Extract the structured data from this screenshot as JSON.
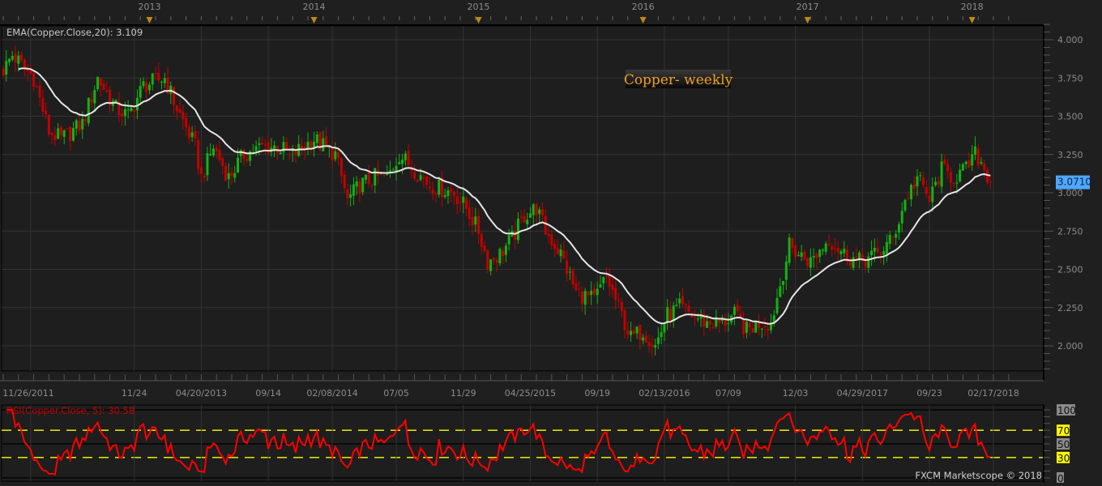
{
  "chart_data": [
    {
      "type": "candlestick",
      "title": "Copper- weekly",
      "instrument": "Copper",
      "timeframe": "weekly",
      "indicator_label": "EMA(Copper.Close,20): 3.109",
      "ema_period": 20,
      "current_price_label": "3.0710",
      "ylim": [
        1.83,
        4.1
      ],
      "y_ticks": [
        "4.000",
        "3.750",
        "3.500",
        "3.250",
        "3.000",
        "2.750",
        "2.500",
        "2.250",
        "2.000"
      ],
      "y_tick_values": [
        4.0,
        3.75,
        3.5,
        3.25,
        3.0,
        2.75,
        2.5,
        2.25,
        2.0
      ],
      "years": [
        "2013",
        "2014",
        "2015",
        "2016",
        "2017",
        "2018"
      ],
      "year_week_index": [
        48,
        102,
        156,
        210,
        264,
        318
      ],
      "x_tick_labels": [
        "11/26/2011",
        "11/24",
        "04/20/2013",
        "09/14",
        "02/08/2014",
        "07/05",
        "11/29",
        "04/25/2015",
        "09/19",
        "02/13/2016",
        "07/09",
        "12/03",
        "04/29/2017",
        "09/23",
        "02/17/2018"
      ],
      "x_tick_week_index": [
        9,
        43,
        65,
        87,
        108,
        129,
        151,
        173,
        195,
        217,
        238,
        260,
        282,
        304,
        325
      ],
      "weeks": 324,
      "close_anchors_week_price": [
        [
          0,
          3.8
        ],
        [
          3,
          3.9
        ],
        [
          10,
          3.75
        ],
        [
          15,
          3.4
        ],
        [
          19,
          3.35
        ],
        [
          26,
          3.45
        ],
        [
          31,
          3.75
        ],
        [
          37,
          3.55
        ],
        [
          41,
          3.5
        ],
        [
          46,
          3.7
        ],
        [
          53,
          3.75
        ],
        [
          57,
          3.55
        ],
        [
          63,
          3.3
        ],
        [
          65,
          3.1
        ],
        [
          69,
          3.3
        ],
        [
          74,
          3.1
        ],
        [
          79,
          3.25
        ],
        [
          85,
          3.3
        ],
        [
          90,
          3.3
        ],
        [
          95,
          3.25
        ],
        [
          102,
          3.35
        ],
        [
          109,
          3.25
        ],
        [
          113,
          2.95
        ],
        [
          117,
          3.05
        ],
        [
          122,
          3.1
        ],
        [
          126,
          3.1
        ],
        [
          130,
          3.25
        ],
        [
          135,
          3.15
        ],
        [
          140,
          3.05
        ],
        [
          148,
          3.0
        ],
        [
          152,
          2.9
        ],
        [
          156,
          2.75
        ],
        [
          159,
          2.55
        ],
        [
          163,
          2.6
        ],
        [
          167,
          2.7
        ],
        [
          171,
          2.85
        ],
        [
          175,
          2.9
        ],
        [
          178,
          2.75
        ],
        [
          183,
          2.6
        ],
        [
          188,
          2.35
        ],
        [
          194,
          2.3
        ],
        [
          198,
          2.45
        ],
        [
          202,
          2.25
        ],
        [
          206,
          2.05
        ],
        [
          210,
          2.1
        ],
        [
          214,
          2.0
        ],
        [
          218,
          2.2
        ],
        [
          222,
          2.25
        ],
        [
          226,
          2.2
        ],
        [
          231,
          2.15
        ],
        [
          236,
          2.15
        ],
        [
          240,
          2.2
        ],
        [
          244,
          2.1
        ],
        [
          248,
          2.15
        ],
        [
          252,
          2.15
        ],
        [
          255,
          2.4
        ],
        [
          258,
          2.65
        ],
        [
          261,
          2.6
        ],
        [
          265,
          2.55
        ],
        [
          271,
          2.7
        ],
        [
          276,
          2.6
        ],
        [
          281,
          2.55
        ],
        [
          287,
          2.6
        ],
        [
          292,
          2.7
        ],
        [
          296,
          2.95
        ],
        [
          300,
          3.1
        ],
        [
          304,
          2.95
        ],
        [
          308,
          3.15
        ],
        [
          312,
          3.1
        ],
        [
          316,
          3.15
        ],
        [
          319,
          3.25
        ],
        [
          321,
          3.2
        ],
        [
          324,
          3.071
        ]
      ]
    },
    {
      "type": "line",
      "indicator_label": "RSI(Copper.Close, 5): 30.58",
      "rsi_period": 5,
      "last_value": 30.58,
      "ylim": [
        0,
        100
      ],
      "levels": [
        30,
        70
      ],
      "y_ticks": [
        "100",
        "70",
        "50",
        "30",
        "0"
      ],
      "y_tick_values": [
        100,
        70,
        50,
        30,
        0
      ]
    }
  ],
  "colors": {
    "background": "#1e1e1e",
    "up_candle": "#12b312",
    "down_candle": "#c40000",
    "ema_line": "#e6e6e6",
    "rsi_line": "#ff0000",
    "rsi_levels": "#ffff00",
    "current_price_bg": "#4fa8ff",
    "title_text": "#f0a020",
    "year_marker": "#c08a10"
  },
  "footer": {
    "copyright": "FXCM Marketscope © 2018"
  }
}
